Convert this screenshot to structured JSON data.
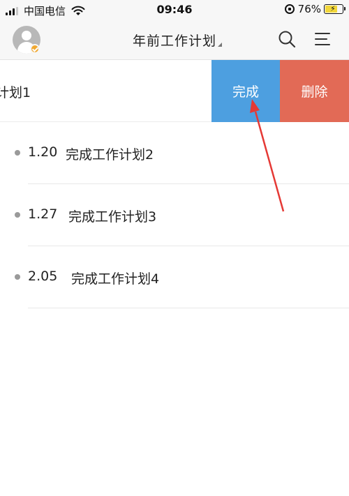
{
  "status_bar": {
    "carrier": "中国电信",
    "time": "09:46",
    "battery_percent": "76%",
    "battery_level": 0.76
  },
  "header": {
    "title": "年前工作计划"
  },
  "swiped_row": {
    "label": "计划1",
    "complete_label": "完成",
    "delete_label": "删除"
  },
  "tasks": [
    {
      "date": "1.20",
      "text": "完成工作计划2"
    },
    {
      "date": "1.27",
      "text": "完成工作计划3"
    },
    {
      "date": "2.05",
      "text": "完成工作计划4"
    }
  ],
  "colors": {
    "complete": "#4d9fe0",
    "delete": "#e26a56",
    "annotation_arrow": "#e53935"
  }
}
